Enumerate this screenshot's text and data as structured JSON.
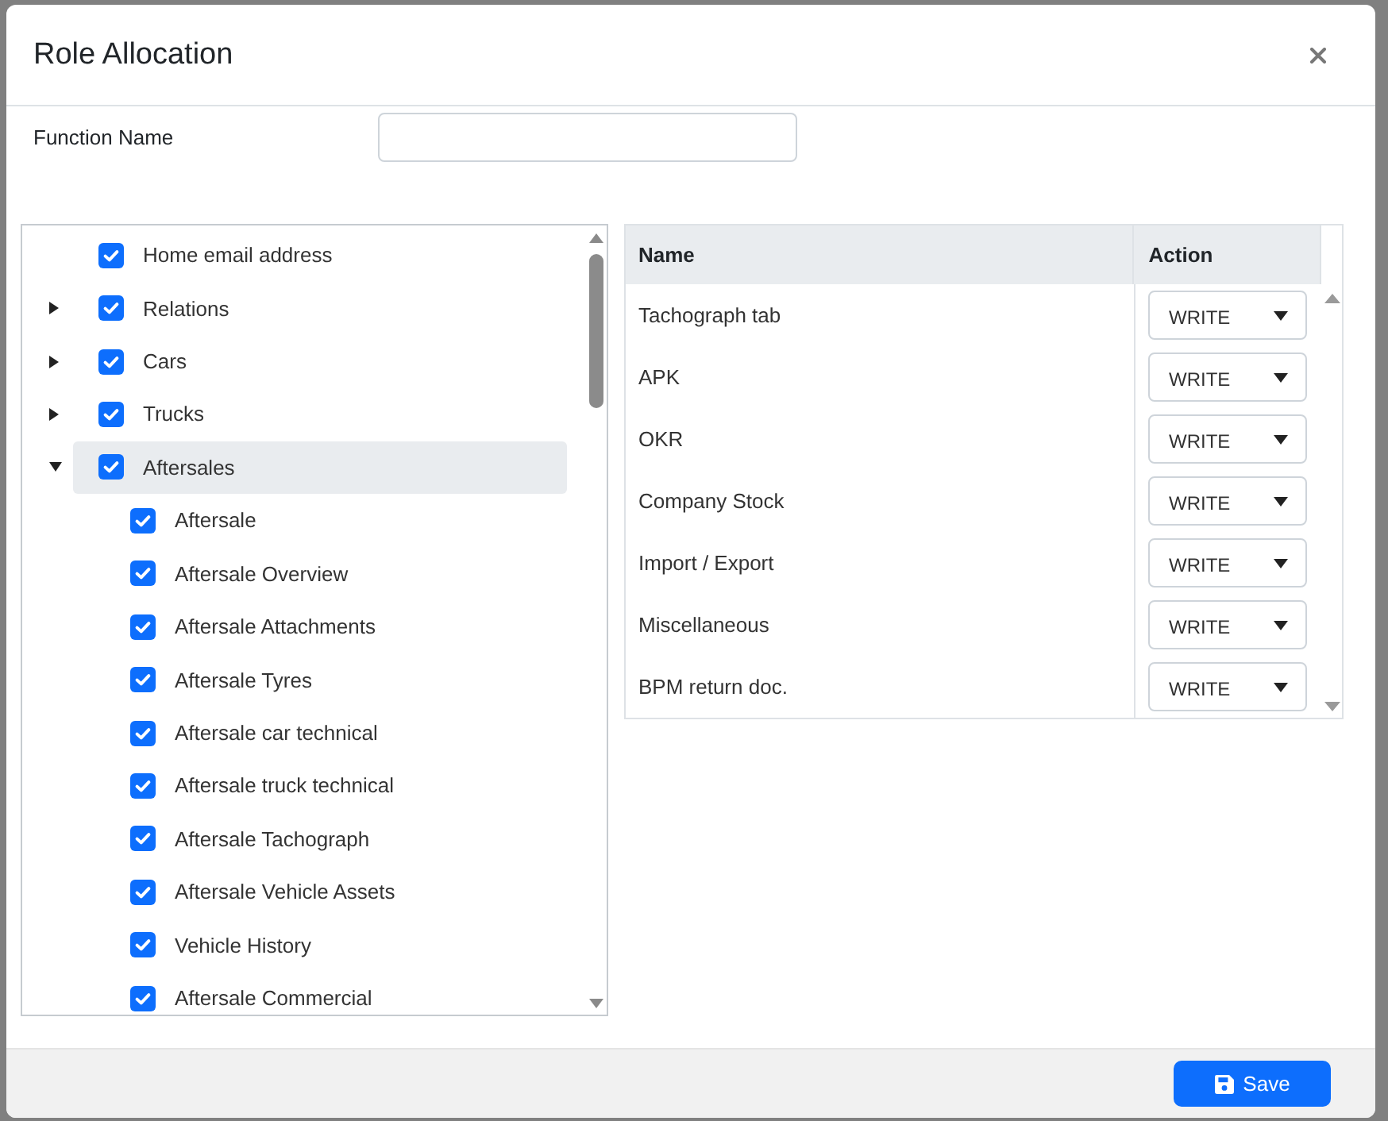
{
  "window": {
    "title": "Role Allocation"
  },
  "form": {
    "function_name": {
      "label": "Function Name"
    }
  },
  "tree": {
    "items": [
      {
        "label": "Home email address",
        "checked": true,
        "selected": false
      },
      {
        "label": "Relations",
        "checked": true,
        "selected": false,
        "expanded": false
      },
      {
        "label": "Cars",
        "checked": true,
        "selected": false,
        "expanded": false
      },
      {
        "label": "Trucks",
        "checked": true,
        "selected": false,
        "expanded": false
      },
      {
        "label": "Aftersales",
        "checked": true,
        "selected": true,
        "expanded": true,
        "children": [
          {
            "label": "Aftersale",
            "checked": true,
            "selected": false
          },
          {
            "label": "Aftersale Overview",
            "checked": true,
            "selected": false
          },
          {
            "label": "Aftersale Attachments",
            "checked": true,
            "selected": false
          },
          {
            "label": "Aftersale Tyres",
            "checked": true,
            "selected": false
          },
          {
            "label": "Aftersale car technical",
            "checked": true,
            "selected": false
          },
          {
            "label": "Aftersale truck technical",
            "checked": true,
            "selected": false
          },
          {
            "label": "Aftersale Tachograph",
            "checked": true,
            "selected": false
          },
          {
            "label": "Aftersale Vehicle Assets",
            "checked": true,
            "selected": false
          },
          {
            "label": "Vehicle History",
            "checked": true,
            "selected": false
          },
          {
            "label": "Aftersale Commercial",
            "checked": true,
            "selected": false
          }
        ]
      }
    ]
  },
  "table": {
    "columns": [
      "Name",
      "Action"
    ],
    "rows": [
      {
        "name": "Tachograph tab",
        "action": "WRITE"
      },
      {
        "name": "APK",
        "action": "WRITE"
      },
      {
        "name": "OKR",
        "action": "WRITE"
      },
      {
        "name": "Company Stock",
        "action": "WRITE"
      },
      {
        "name": "Import / Export",
        "action": "WRITE"
      },
      {
        "name": "Miscellaneous",
        "action": "WRITE"
      },
      {
        "name": "BPM return doc.",
        "action": "WRITE"
      }
    ]
  },
  "footer": {
    "save_button": {
      "label": "Save"
    }
  }
}
